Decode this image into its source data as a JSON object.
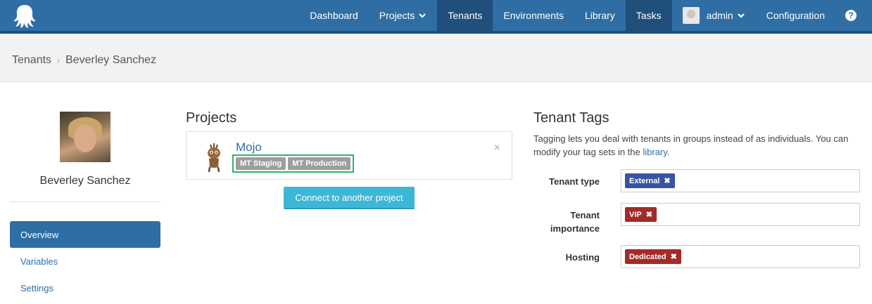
{
  "nav": {
    "items": [
      {
        "label": "Dashboard"
      },
      {
        "label": "Projects"
      },
      {
        "label": "Tenants"
      },
      {
        "label": "Environments"
      },
      {
        "label": "Library"
      },
      {
        "label": "Tasks"
      },
      {
        "label": "admin"
      },
      {
        "label": "Configuration"
      }
    ],
    "help_glyph": "?"
  },
  "breadcrumb": {
    "parent": "Tenants",
    "separator": "›",
    "current": "Beverley Sanchez"
  },
  "profile": {
    "name": "Beverley Sanchez"
  },
  "side_nav": {
    "items": [
      {
        "label": "Overview"
      },
      {
        "label": "Variables"
      },
      {
        "label": "Settings"
      }
    ]
  },
  "projects": {
    "title": "Projects",
    "card": {
      "name": "Mojo",
      "environments": [
        "MT Staging",
        "MT Production"
      ],
      "remove_glyph": "×"
    },
    "connect_label": "Connect to another project"
  },
  "tenant_tags": {
    "title": "Tenant Tags",
    "description_prefix": "Tagging lets you deal with tenants in groups instead of as individuals. You can modify your tag sets in the ",
    "description_link": "library",
    "description_suffix": ".",
    "rows": [
      {
        "label": "Tenant type",
        "tag": "External",
        "color": "#3753a4"
      },
      {
        "label": "Tenant importance",
        "tag": "VIP",
        "color": "#a42a2a"
      },
      {
        "label": "Hosting",
        "tag": "Dedicated",
        "color": "#a42a2a"
      }
    ],
    "remove_glyph": "✖"
  },
  "colors": {
    "nav_bg": "#2f6ea4",
    "nav_active": "#1f4f7a",
    "link": "#2f6ea4",
    "connect_button": "#3db7d6",
    "env_tag": "#9e9e9e",
    "highlight": "#2db36f"
  }
}
